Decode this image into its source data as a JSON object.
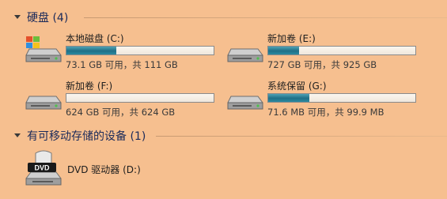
{
  "groups": {
    "hard_disks": {
      "title": "硬盘 (4)"
    },
    "removable": {
      "title": "有可移动存储的设备 (1)"
    }
  },
  "drives": [
    {
      "name": "本地磁盘 (C:)",
      "stats": "73.1 GB 可用，共 111 GB",
      "used_fraction": 0.34,
      "icon": "windows-hard-drive-icon"
    },
    {
      "name": "新加卷 (E:)",
      "stats": "727 GB 可用，共 925 GB",
      "used_fraction": 0.21,
      "icon": "hard-drive-icon"
    },
    {
      "name": "新加卷 (F:)",
      "stats": "624 GB 可用，共 624 GB",
      "used_fraction": 0.0,
      "icon": "hard-drive-icon"
    },
    {
      "name": "系统保留 (G:)",
      "stats": "71.6 MB 可用，共 99.9 MB",
      "used_fraction": 0.28,
      "icon": "hard-drive-icon"
    }
  ],
  "dvd": {
    "name": "DVD 驱动器 (D:)",
    "icon_label": "DVD",
    "icon": "dvd-drive-icon"
  },
  "colors": {
    "background": "#f6bf8f",
    "bar_fill": "#1f6f86",
    "header_text": "#1b2a5a"
  }
}
